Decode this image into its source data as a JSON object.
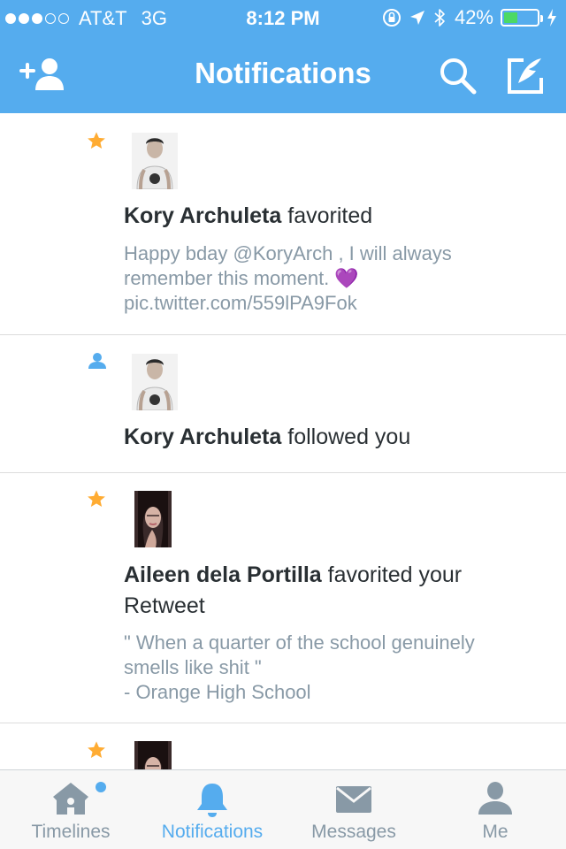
{
  "status_bar": {
    "carrier": "AT&T",
    "network": "3G",
    "time": "8:12 PM",
    "battery_percent": "42%",
    "battery_level": 0.42,
    "signal_bars": 3,
    "signal_total": 5,
    "battery_color": "#4cd964"
  },
  "header": {
    "title": "Notifications",
    "background": "#55acee",
    "left_button_icon": "add-person-icon",
    "search_icon": "search-icon",
    "compose_icon": "compose-icon"
  },
  "notifications": [
    {
      "type_icon": "star-icon",
      "user": "Kory Archuleta",
      "action": " favorited",
      "body_lines": [
        "Happy bday @KoryArch , I will always",
        "remember this moment. 💜",
        "pic.twitter.com/559lPA9Fok"
      ]
    },
    {
      "type_icon": "person-icon",
      "user": "Kory Archuleta",
      "action": " followed you"
    },
    {
      "type_icon": "star-icon",
      "user": "Aileen dela Portilla",
      "action": " favorited your",
      "action_line2": "Retweet",
      "body_lines": [
        "\" When a quarter of the school genuinely",
        "smells like shit \"",
        "- Orange High School"
      ]
    },
    {
      "type_icon": "star-icon"
    }
  ],
  "tabs": [
    {
      "label": "Timelines",
      "icon": "home-icon",
      "badge_dot": true
    },
    {
      "label": "Notifications",
      "icon": "bell-icon",
      "active": true
    },
    {
      "label": "Messages",
      "icon": "envelope-icon"
    },
    {
      "label": "Me",
      "icon": "person-icon"
    }
  ],
  "colors": {
    "accent": "#55acee",
    "star": "#ffac33",
    "secondary_text": "#8899a6",
    "inactive_icon": "#8899a6"
  }
}
